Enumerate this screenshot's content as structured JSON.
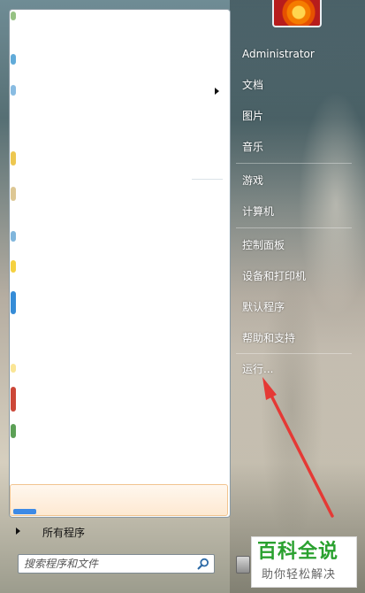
{
  "start_menu": {
    "user_name": "Administrator",
    "all_programs": "所有程序",
    "search_placeholder": "搜索程序和文件",
    "right_items": [
      "文档",
      "图片",
      "音乐",
      "游戏",
      "计算机",
      "控制面板",
      "设备和打印机",
      "默认程序",
      "帮助和支持",
      "运行..."
    ]
  },
  "watermark": {
    "title": "百科全说",
    "subtitle": "助你轻松解决"
  },
  "colors": {
    "annotation_arrow": "#e53935",
    "watermark_green": "#2aa12f"
  },
  "icons": {
    "search": "search-icon",
    "submenu": "chevron-right-icon",
    "all_programs": "triangle-right-icon"
  }
}
